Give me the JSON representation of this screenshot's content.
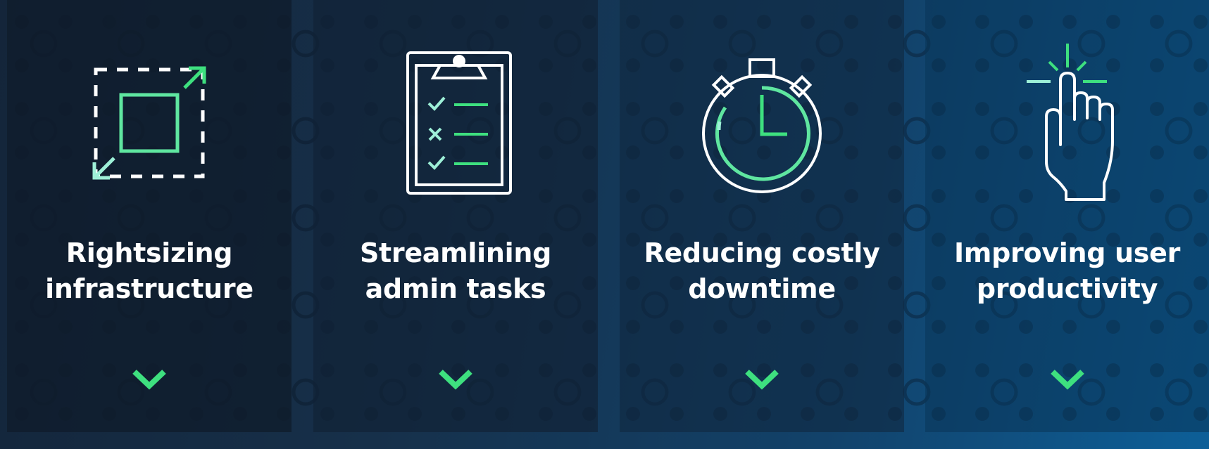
{
  "colors": {
    "accent_green": "#3ee07f",
    "accent_mint": "#9ef0d8",
    "text": "#ffffff",
    "icon_stroke": "#ffffff"
  },
  "cards": [
    {
      "title_line1": "Rightsizing",
      "title_line2": "infrastructure",
      "icon": "resize-icon"
    },
    {
      "title_line1": "Streamlining",
      "title_line2": "admin tasks",
      "icon": "clipboard-checklist-icon"
    },
    {
      "title_line1": "Reducing costly",
      "title_line2": "downtime",
      "icon": "stopwatch-icon"
    },
    {
      "title_line1": "Improving user",
      "title_line2": "productivity",
      "icon": "pointing-hand-tap-icon"
    }
  ]
}
